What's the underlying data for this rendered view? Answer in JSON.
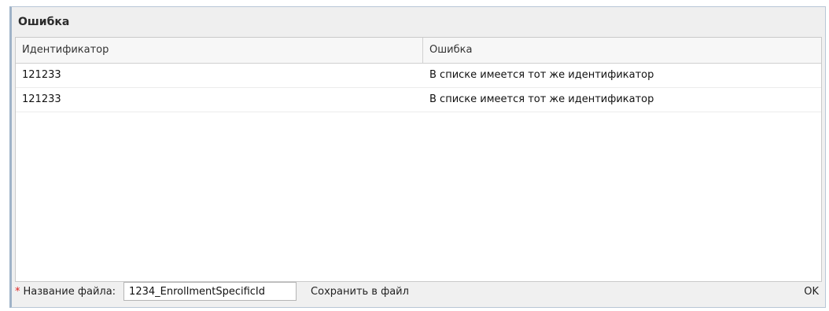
{
  "dialog": {
    "title": "Ошибка"
  },
  "grid": {
    "columns": [
      "Идентификатор",
      "Ошибка"
    ],
    "rows": [
      {
        "id": "121233",
        "error": "В списке имеется тот же идентификатор"
      },
      {
        "id": "121233",
        "error": "В списке имеется тот же идентификатор"
      }
    ]
  },
  "footer": {
    "required_mark": "*",
    "filename_label": "Название файла:",
    "filename_value": "1234_EnrollmentSpecificId",
    "save_label": "Сохранить в файл",
    "ok_label": "OK"
  },
  "colors": {
    "required": "#dd2222",
    "border": "#b8c6d6"
  }
}
